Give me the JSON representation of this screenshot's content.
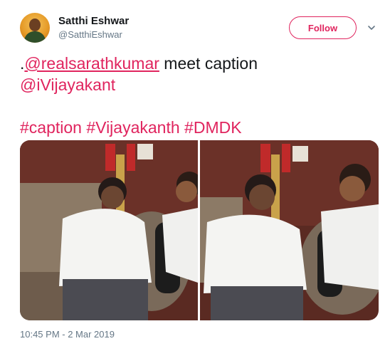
{
  "user": {
    "name": "Satthi Eshwar",
    "handle": "@SatthiEshwar"
  },
  "follow_button": {
    "label": "Follow"
  },
  "tweet": {
    "prefix": ".",
    "mention1": "@realsarathkumar",
    "text_mid": " meet caption",
    "mention2": "@iVijayakant",
    "hashtags": [
      "#caption",
      "#Vijayakanth",
      "#DMDK"
    ]
  },
  "timestamp": "10:45 PM - 2 Mar 2019",
  "colors": {
    "accent": "#e0245e",
    "secondary_text": "#657786"
  },
  "icons": {
    "more": "chevron-down-icon"
  }
}
